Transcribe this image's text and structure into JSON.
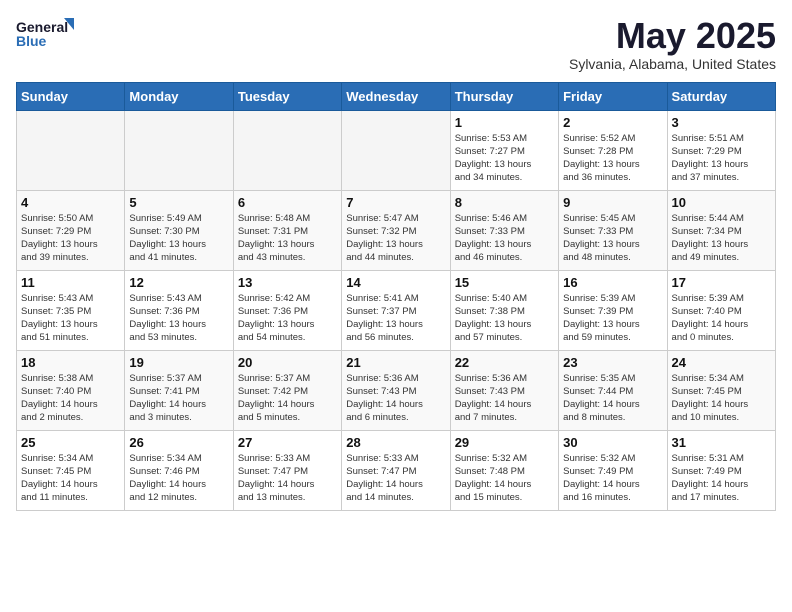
{
  "header": {
    "logo_line1": "General",
    "logo_line2": "Blue",
    "month": "May 2025",
    "location": "Sylvania, Alabama, United States"
  },
  "weekdays": [
    "Sunday",
    "Monday",
    "Tuesday",
    "Wednesday",
    "Thursday",
    "Friday",
    "Saturday"
  ],
  "weeks": [
    [
      {
        "day": "",
        "info": ""
      },
      {
        "day": "",
        "info": ""
      },
      {
        "day": "",
        "info": ""
      },
      {
        "day": "",
        "info": ""
      },
      {
        "day": "1",
        "info": "Sunrise: 5:53 AM\nSunset: 7:27 PM\nDaylight: 13 hours\nand 34 minutes."
      },
      {
        "day": "2",
        "info": "Sunrise: 5:52 AM\nSunset: 7:28 PM\nDaylight: 13 hours\nand 36 minutes."
      },
      {
        "day": "3",
        "info": "Sunrise: 5:51 AM\nSunset: 7:29 PM\nDaylight: 13 hours\nand 37 minutes."
      }
    ],
    [
      {
        "day": "4",
        "info": "Sunrise: 5:50 AM\nSunset: 7:29 PM\nDaylight: 13 hours\nand 39 minutes."
      },
      {
        "day": "5",
        "info": "Sunrise: 5:49 AM\nSunset: 7:30 PM\nDaylight: 13 hours\nand 41 minutes."
      },
      {
        "day": "6",
        "info": "Sunrise: 5:48 AM\nSunset: 7:31 PM\nDaylight: 13 hours\nand 43 minutes."
      },
      {
        "day": "7",
        "info": "Sunrise: 5:47 AM\nSunset: 7:32 PM\nDaylight: 13 hours\nand 44 minutes."
      },
      {
        "day": "8",
        "info": "Sunrise: 5:46 AM\nSunset: 7:33 PM\nDaylight: 13 hours\nand 46 minutes."
      },
      {
        "day": "9",
        "info": "Sunrise: 5:45 AM\nSunset: 7:33 PM\nDaylight: 13 hours\nand 48 minutes."
      },
      {
        "day": "10",
        "info": "Sunrise: 5:44 AM\nSunset: 7:34 PM\nDaylight: 13 hours\nand 49 minutes."
      }
    ],
    [
      {
        "day": "11",
        "info": "Sunrise: 5:43 AM\nSunset: 7:35 PM\nDaylight: 13 hours\nand 51 minutes."
      },
      {
        "day": "12",
        "info": "Sunrise: 5:43 AM\nSunset: 7:36 PM\nDaylight: 13 hours\nand 53 minutes."
      },
      {
        "day": "13",
        "info": "Sunrise: 5:42 AM\nSunset: 7:36 PM\nDaylight: 13 hours\nand 54 minutes."
      },
      {
        "day": "14",
        "info": "Sunrise: 5:41 AM\nSunset: 7:37 PM\nDaylight: 13 hours\nand 56 minutes."
      },
      {
        "day": "15",
        "info": "Sunrise: 5:40 AM\nSunset: 7:38 PM\nDaylight: 13 hours\nand 57 minutes."
      },
      {
        "day": "16",
        "info": "Sunrise: 5:39 AM\nSunset: 7:39 PM\nDaylight: 13 hours\nand 59 minutes."
      },
      {
        "day": "17",
        "info": "Sunrise: 5:39 AM\nSunset: 7:40 PM\nDaylight: 14 hours\nand 0 minutes."
      }
    ],
    [
      {
        "day": "18",
        "info": "Sunrise: 5:38 AM\nSunset: 7:40 PM\nDaylight: 14 hours\nand 2 minutes."
      },
      {
        "day": "19",
        "info": "Sunrise: 5:37 AM\nSunset: 7:41 PM\nDaylight: 14 hours\nand 3 minutes."
      },
      {
        "day": "20",
        "info": "Sunrise: 5:37 AM\nSunset: 7:42 PM\nDaylight: 14 hours\nand 5 minutes."
      },
      {
        "day": "21",
        "info": "Sunrise: 5:36 AM\nSunset: 7:43 PM\nDaylight: 14 hours\nand 6 minutes."
      },
      {
        "day": "22",
        "info": "Sunrise: 5:36 AM\nSunset: 7:43 PM\nDaylight: 14 hours\nand 7 minutes."
      },
      {
        "day": "23",
        "info": "Sunrise: 5:35 AM\nSunset: 7:44 PM\nDaylight: 14 hours\nand 8 minutes."
      },
      {
        "day": "24",
        "info": "Sunrise: 5:34 AM\nSunset: 7:45 PM\nDaylight: 14 hours\nand 10 minutes."
      }
    ],
    [
      {
        "day": "25",
        "info": "Sunrise: 5:34 AM\nSunset: 7:45 PM\nDaylight: 14 hours\nand 11 minutes."
      },
      {
        "day": "26",
        "info": "Sunrise: 5:34 AM\nSunset: 7:46 PM\nDaylight: 14 hours\nand 12 minutes."
      },
      {
        "day": "27",
        "info": "Sunrise: 5:33 AM\nSunset: 7:47 PM\nDaylight: 14 hours\nand 13 minutes."
      },
      {
        "day": "28",
        "info": "Sunrise: 5:33 AM\nSunset: 7:47 PM\nDaylight: 14 hours\nand 14 minutes."
      },
      {
        "day": "29",
        "info": "Sunrise: 5:32 AM\nSunset: 7:48 PM\nDaylight: 14 hours\nand 15 minutes."
      },
      {
        "day": "30",
        "info": "Sunrise: 5:32 AM\nSunset: 7:49 PM\nDaylight: 14 hours\nand 16 minutes."
      },
      {
        "day": "31",
        "info": "Sunrise: 5:31 AM\nSunset: 7:49 PM\nDaylight: 14 hours\nand 17 minutes."
      }
    ]
  ]
}
